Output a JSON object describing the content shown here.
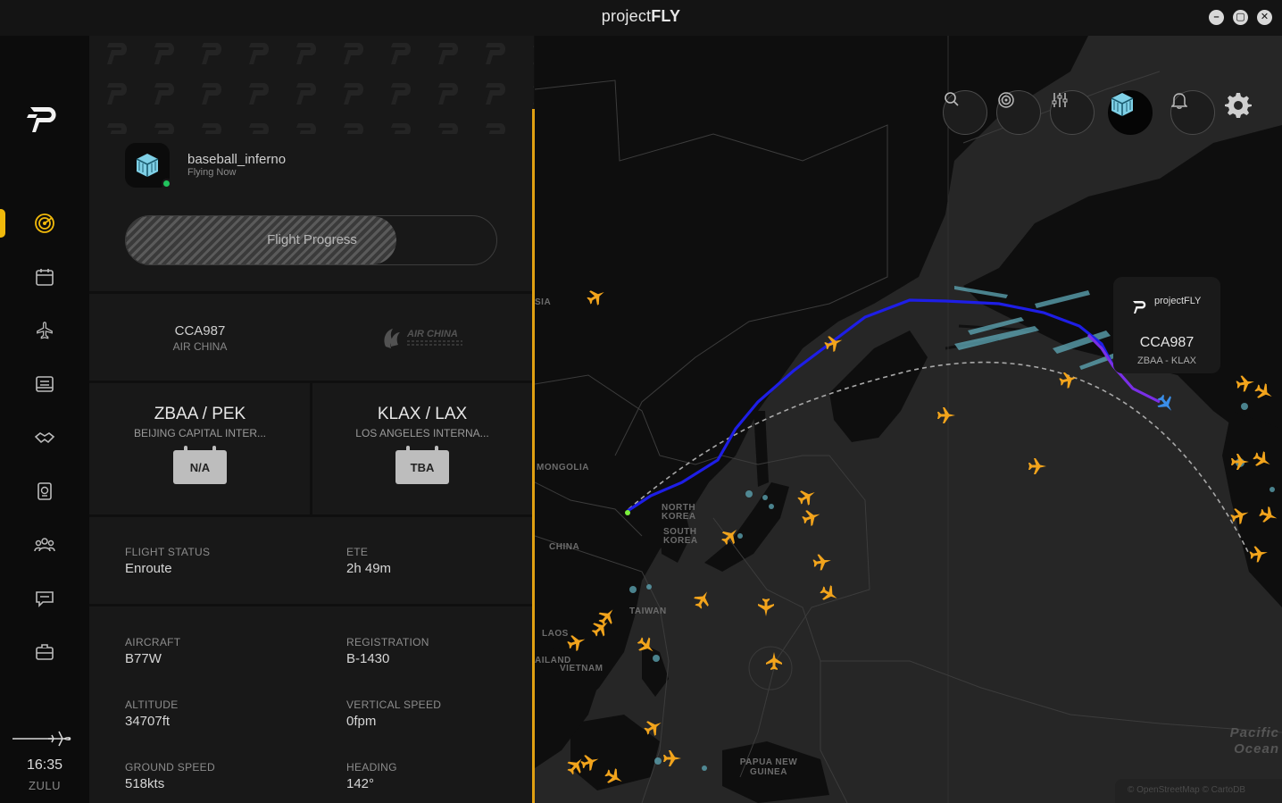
{
  "window": {
    "title_light": "project",
    "title_bold": "FLY",
    "minimize": "–",
    "maximize": "▢",
    "close": "✕"
  },
  "rail": {
    "nav": [
      "radar",
      "calendar",
      "flights",
      "logbook",
      "partners",
      "passport",
      "community",
      "chat",
      "jobs"
    ],
    "clock_time": "16:35",
    "clock_zone": "ZULU"
  },
  "pilot": {
    "username": "baseball_inferno",
    "status": "Flying Now"
  },
  "progress": {
    "label": "Flight Progress",
    "fraction": 0.73
  },
  "flight": {
    "number": "CCA987",
    "airline": "AIR CHINA",
    "airline_logo_text": "AIR CHINA"
  },
  "departure": {
    "code": "ZBAA / PEK",
    "name": "BEIJING CAPITAL INTER...",
    "time": "N/A"
  },
  "arrival": {
    "code": "KLAX / LAX",
    "name": "LOS ANGELES INTERNA...",
    "time": "TBA"
  },
  "stats": {
    "flight_status_label": "FLIGHT STATUS",
    "flight_status": "Enroute",
    "ete_label": "ETE",
    "ete": "2h 49m",
    "aircraft_label": "AIRCRAFT",
    "aircraft": "B77W",
    "registration_label": "REGISTRATION",
    "registration": "B-1430",
    "altitude_label": "ALTITUDE",
    "altitude": "34707ft",
    "vertical_speed_label": "VERTICAL SPEED",
    "vertical_speed": "0fpm",
    "ground_speed_label": "GROUND SPEED",
    "ground_speed": "518kts",
    "heading_label": "HEADING",
    "heading": "142°"
  },
  "map": {
    "labels": {
      "mongolia": "MONGOLIA",
      "china": "CHINA",
      "north_korea": "NORTH KOREA",
      "south_korea": "SOUTH KOREA",
      "taiwan": "TAIWAN",
      "vietnam": "VIETNAM",
      "laos": "LAOS",
      "thailand": "AILAND",
      "papua": "PAPUA NEW GUINEA",
      "russia_fragment": "SIA",
      "ocean": "Pacific Ocean"
    },
    "popup": {
      "brand": "projectFLY",
      "flight": "CCA987",
      "route": "ZBAA - KLAX"
    },
    "attribution": "© OpenStreetMap © CartoDB",
    "colors": {
      "flown_track": "#1e1ee6",
      "accent": "#f0b90b",
      "traffic": "#f2a41c"
    }
  }
}
